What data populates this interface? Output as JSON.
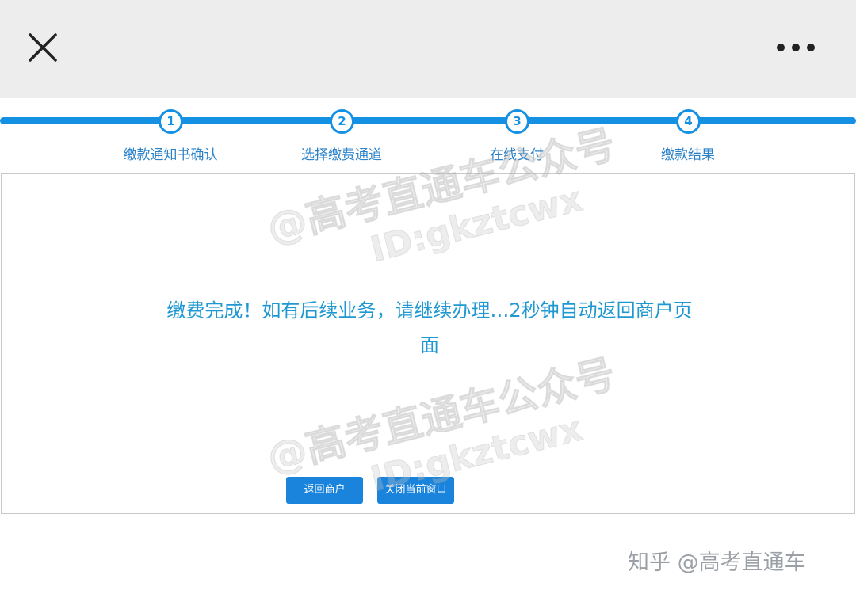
{
  "header": {
    "close_icon": "close-icon",
    "more_icon": "more-horizontal-icon"
  },
  "steps": [
    {
      "number": "1",
      "label": "缴款通知书确认"
    },
    {
      "number": "2",
      "label": "选择缴费通道"
    },
    {
      "number": "3",
      "label": "在线支付"
    },
    {
      "number": "4",
      "label": "缴款结果"
    }
  ],
  "result": {
    "message": "缴费完成！如有后续业务，请继续办理…2秒钟自动返回商户页面"
  },
  "buttons": {
    "return_merchant": "返回商户",
    "close_window": "关闭当前窗口"
  },
  "watermark": {
    "line1": "@高考直通车公众号",
    "line2": "ID:gkztcwx"
  },
  "credit": "知乎 @高考直通车",
  "colors": {
    "accent": "#1591e3",
    "message": "#1f98d1",
    "button": "#1a84dc",
    "topbar": "#ededee"
  }
}
